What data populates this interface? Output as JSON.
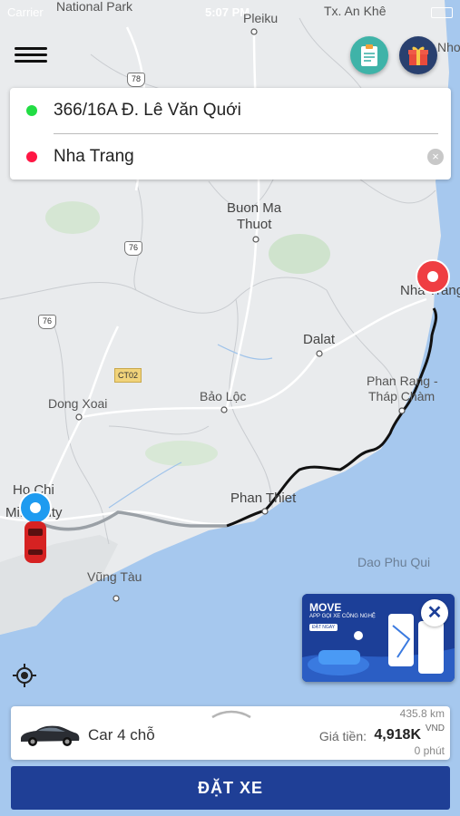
{
  "status_bar": {
    "carrier": "Carrier",
    "time": "5:07 PM"
  },
  "top_buttons": {
    "notes_icon": "clipboard-icon",
    "gift_icon": "gift-icon",
    "menu_icon": "hamburger-menu-icon"
  },
  "route": {
    "origin": "366/16A Đ. Lê Văn Quới",
    "destination": "Nha Trang",
    "origin_color": "#22dd44",
    "destination_color": "#ff1744",
    "route_color": "#111111"
  },
  "map": {
    "labels": {
      "national_park": "National Park",
      "pleiku": "Pleiku",
      "tx_an_khe": "Tx. An Khê",
      "nhon": "Nhơ",
      "buon_ma_thuot_1": "Buon Ma",
      "buon_ma_thuot_2": "Thuot",
      "nha_trang": "Nha Trang",
      "dalat": "Dalat",
      "phan_rang_1": "Phan Rang -",
      "phan_rang_2": "Tháp Chàm",
      "dong_xoai": "Dong Xoai",
      "bao_loc": "Bảo Lộc",
      "phan_thiet": "Phan Thiet",
      "ho_chi_minh_1": "Ho Chi",
      "ho_chi_minh_2": "Minh City",
      "vung_tau": "Vũng Tàu",
      "dao_phu_qui": "Dao Phu Qui"
    },
    "shields": {
      "s78": "78",
      "s76a": "76",
      "s76b": "76",
      "ct02": "CT02"
    }
  },
  "ad": {
    "brand": "MOVE",
    "tagline": "APP GỌI XE CÔNG NGHỆ",
    "cta": "ĐẶT NGAY"
  },
  "trip": {
    "car_type": "Car 4 chỗ",
    "distance": "435.8 km",
    "price_label": "Giá tiền:",
    "price": "4,918K",
    "currency": "VND",
    "duration": "0 phút"
  },
  "book_button": "ĐẶT XE"
}
